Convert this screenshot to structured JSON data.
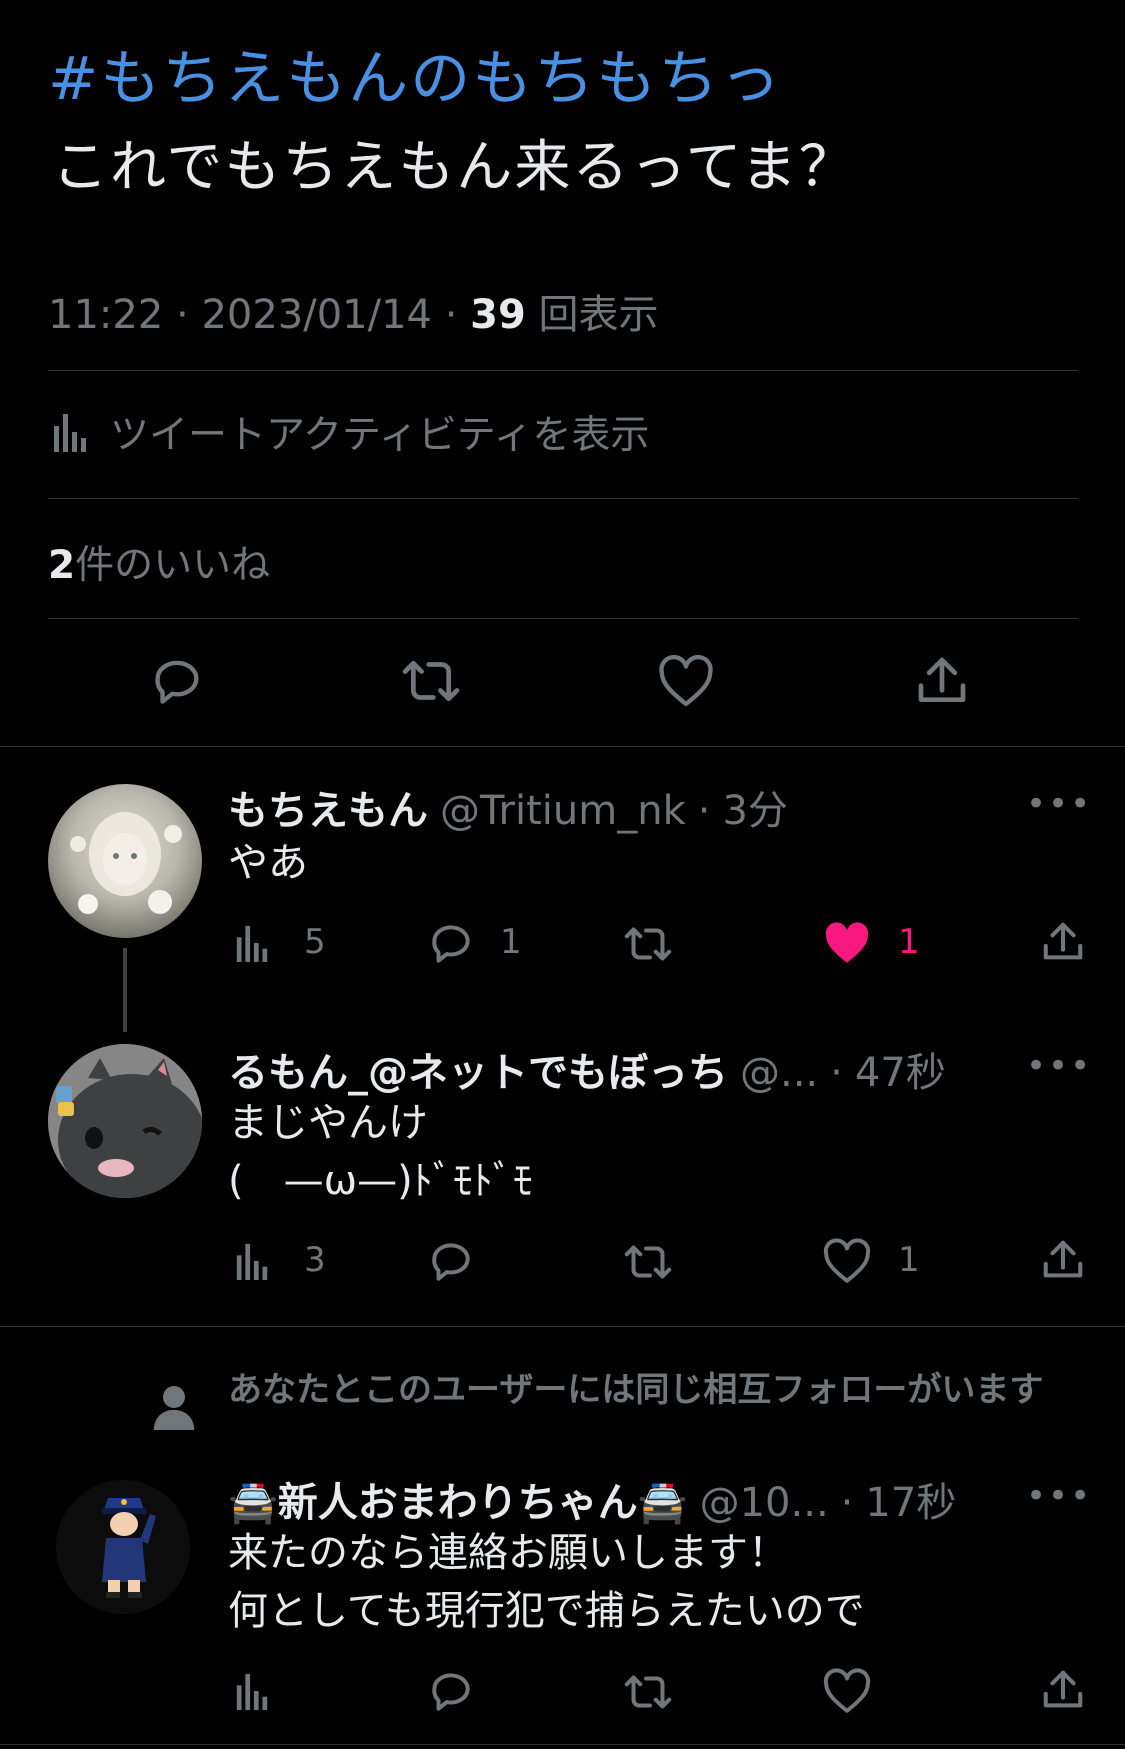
{
  "tweet": {
    "hashtag": "#もちえもんのもちもちっ",
    "text": "これでもちえもん来るってま？",
    "time": "11:22",
    "date": "2023/01/14",
    "views_count": "39",
    "views_label": "回表示",
    "activity_label": "ツイートアクティビティを表示",
    "likes_count": "2",
    "likes_label": "件のいいね"
  },
  "replies": [
    {
      "name": "もちえもん",
      "handle": "@Tritium_nk",
      "time": "3分",
      "lines": [
        "やあ"
      ],
      "views": "5",
      "replies": "1",
      "likes": "1",
      "liked": true
    },
    {
      "name": "るもん_@ネットでもぼっち",
      "handle": "@...",
      "time": "47秒",
      "lines": [
        "まじやんけ",
        "(　—ω—)ﾄﾞﾓﾄﾞﾓ"
      ],
      "views": "3",
      "likes": "1",
      "liked": false
    },
    {
      "social_context": "あなたとこのユーザーには同じ相互フォローがいます",
      "name": "🚔新人おまわりちゃん🚔",
      "handle": "@10...",
      "time": "17秒",
      "lines": [
        "来たのなら連絡お願いします！",
        "何としても現行犯で捕らえたいので"
      ]
    }
  ],
  "colors": {
    "accent": "#4a90e2",
    "like": "#f91880",
    "muted": "#71767b"
  }
}
